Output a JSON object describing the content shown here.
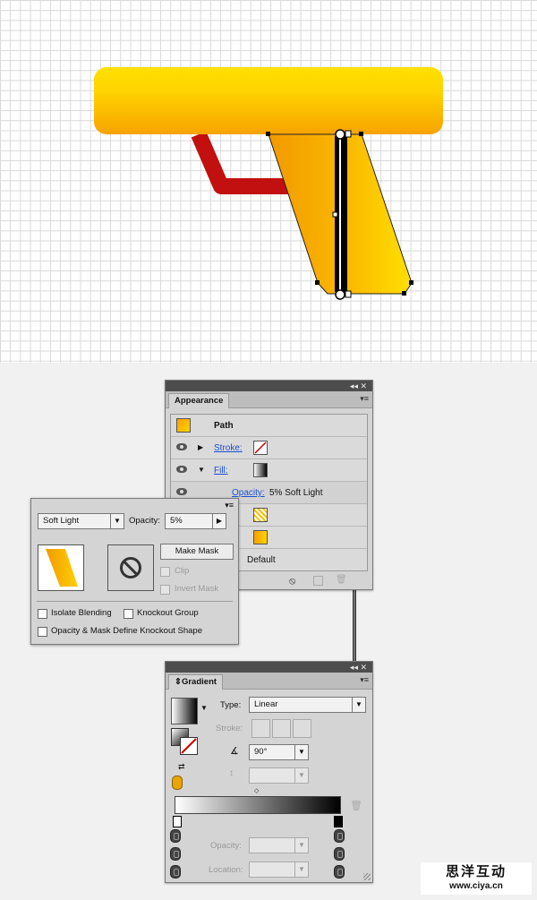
{
  "appearance": {
    "panel_controls": "◂◂ ✕",
    "tab": "Appearance",
    "menu": "▾≡",
    "target": "Path",
    "stroke_label": "Stroke:",
    "fill_label": "Fill:",
    "opacity_label": "Opacity:",
    "opacity_value": "5% Soft Light",
    "bottom_opacity_label": "y:",
    "bottom_opacity_value": "Default"
  },
  "transparency": {
    "menu": "▾≡",
    "blend_mode": "Soft Light",
    "opacity_label": "Opacity:",
    "opacity_value": "5%",
    "make_mask": "Make Mask",
    "clip": "Clip",
    "invert_mask": "Invert Mask",
    "isolate_blending": "Isolate Blending",
    "knockout_group": "Knockout Group",
    "opacity_mask_knockout": "Opacity & Mask Define Knockout Shape"
  },
  "gradient": {
    "panel_controls": "◂◂ ✕",
    "tab": "Gradient",
    "menu": "▾≡",
    "type_label": "Type:",
    "type_value": "Linear",
    "stroke_label": "Stroke:",
    "angle_value": "90°",
    "opacity_label": "Opacity:",
    "location_label": "Location:"
  },
  "colors": {
    "gun_yellow": "#ffd200",
    "gun_orange": "#f7a000",
    "handle_red": "#c40f0f"
  },
  "watermark": {
    "line1": "思洋互动",
    "line2": "www.ciya.cn"
  }
}
